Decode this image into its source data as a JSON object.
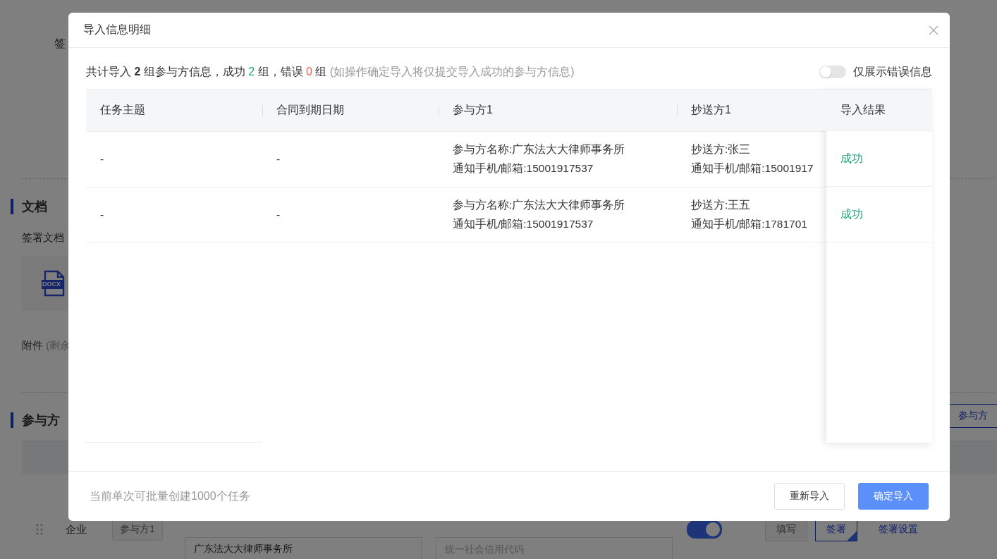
{
  "page": {
    "sign_label": "签",
    "documents": {
      "title": "文档",
      "sign_docs_label": "签署文档",
      "file_type": "DOCX",
      "attachments_label": "附件",
      "attachments_note": "(剩余"
    },
    "participants": {
      "title": "参与方",
      "import_button": "参与方",
      "row": {
        "type": "企业",
        "tag": "参与方1",
        "enabled": true,
        "fill_button": "填写",
        "sign_button": "签署",
        "sign_selected": true,
        "settings_link": "签署设置",
        "name_value": "广东法大大律师事务所",
        "code_placeholder": "统一社会信用代码"
      }
    }
  },
  "dialog": {
    "title": "导入信息明细",
    "summary": {
      "prefix": "共计导入",
      "total": "2",
      "mid": "组参与方信息，成功",
      "success": "2",
      "mid2": "组，错误",
      "error": "0",
      "suffix": "组",
      "note": "(如操作确定导入将仅提交导入成功的参与方信息)"
    },
    "only_errors": {
      "label": "仅展示错误信息",
      "on": false
    },
    "table": {
      "columns": [
        "任务主题",
        "合同到期日期",
        "参与方1",
        "抄送方1"
      ],
      "result_column": "导入结果",
      "rows": [
        {
          "cells": [
            [
              "-"
            ],
            [
              "-"
            ],
            [
              "参与方名称:广东法大大律师事务所",
              "通知手机/邮箱:15001917537"
            ],
            [
              "抄送方:张三",
              "通知手机/邮箱:15001917"
            ]
          ],
          "result": {
            "text": "成功",
            "color": "#21a67a"
          }
        },
        {
          "cells": [
            [
              "-"
            ],
            [
              "-"
            ],
            [
              "参与方名称:广东法大大律师事务所",
              "通知手机/邮箱:15001917537"
            ],
            [
              "抄送方:王五",
              "通知手机/邮箱:1781701"
            ]
          ],
          "result": {
            "text": "成功",
            "color": "#21a67a"
          }
        }
      ]
    },
    "footer_note": "当前单次可批量创建1000个任务",
    "buttons": [
      {
        "label": "重新导入",
        "kind": "default"
      },
      {
        "label": "确定导入",
        "kind": "primary"
      }
    ]
  }
}
